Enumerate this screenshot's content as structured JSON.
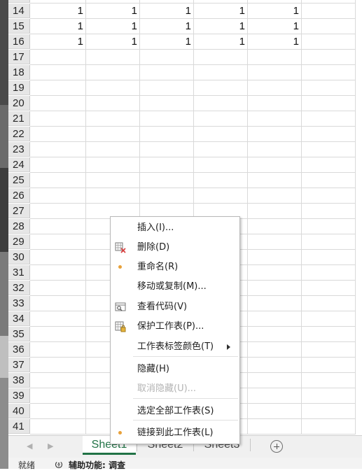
{
  "sheet": {
    "rows": [
      {
        "num": "14",
        "values": [
          "1",
          "1",
          "1",
          "1",
          "1"
        ]
      },
      {
        "num": "15",
        "values": [
          "1",
          "1",
          "1",
          "1",
          "1"
        ]
      },
      {
        "num": "16",
        "values": [
          "1",
          "1",
          "1",
          "1",
          "1"
        ]
      },
      {
        "num": "17",
        "values": []
      },
      {
        "num": "18",
        "values": []
      },
      {
        "num": "19",
        "values": []
      },
      {
        "num": "20",
        "values": []
      },
      {
        "num": "21",
        "values": []
      },
      {
        "num": "22",
        "values": []
      },
      {
        "num": "23",
        "values": []
      },
      {
        "num": "24",
        "values": []
      },
      {
        "num": "25",
        "values": []
      },
      {
        "num": "26",
        "values": []
      },
      {
        "num": "27",
        "values": []
      },
      {
        "num": "28",
        "values": []
      },
      {
        "num": "29",
        "values": []
      },
      {
        "num": "30",
        "values": []
      },
      {
        "num": "31",
        "values": []
      },
      {
        "num": "32",
        "values": []
      },
      {
        "num": "33",
        "values": []
      },
      {
        "num": "34",
        "values": []
      },
      {
        "num": "35",
        "values": []
      },
      {
        "num": "36",
        "values": []
      },
      {
        "num": "37",
        "values": []
      },
      {
        "num": "38",
        "values": []
      },
      {
        "num": "39",
        "values": []
      },
      {
        "num": "40",
        "values": []
      },
      {
        "num": "41",
        "values": []
      }
    ]
  },
  "context_menu": {
    "items": [
      {
        "label": "插入(I)...",
        "icon": "",
        "disabled": false,
        "submenu": false
      },
      {
        "label": "删除(D)",
        "icon": "delete-sheet-icon",
        "disabled": false,
        "submenu": false
      },
      {
        "label": "重命名(R)",
        "icon": "dot",
        "disabled": false,
        "submenu": false
      },
      {
        "label": "移动或复制(M)...",
        "icon": "",
        "disabled": false,
        "submenu": false
      },
      {
        "label": "查看代码(V)",
        "icon": "view-code-icon",
        "disabled": false,
        "submenu": false
      },
      {
        "label": "保护工作表(P)...",
        "icon": "protect-sheet-icon",
        "disabled": false,
        "submenu": false
      },
      {
        "label": "工作表标签颜色(T)",
        "icon": "",
        "disabled": false,
        "submenu": true
      },
      {
        "label": "隐藏(H)",
        "icon": "",
        "disabled": false,
        "submenu": false
      },
      {
        "label": "取消隐藏(U)...",
        "icon": "",
        "disabled": true,
        "submenu": false
      },
      {
        "label": "选定全部工作表(S)",
        "icon": "",
        "disabled": false,
        "submenu": false
      },
      {
        "label": "链接到此工作表(L)",
        "icon": "dot",
        "disabled": false,
        "submenu": false
      }
    ]
  },
  "tabs": [
    {
      "label": "Sheet1",
      "active": true
    },
    {
      "label": "Sheet2",
      "active": false
    },
    {
      "label": "Sheet3",
      "active": false
    }
  ],
  "status": {
    "ready": "就绪",
    "accessibility": "辅助功能: 调查"
  },
  "colors": {
    "accent": "#217346",
    "menu_dot": "#e8a13a",
    "row_header_bg": "#e6e6e6"
  }
}
